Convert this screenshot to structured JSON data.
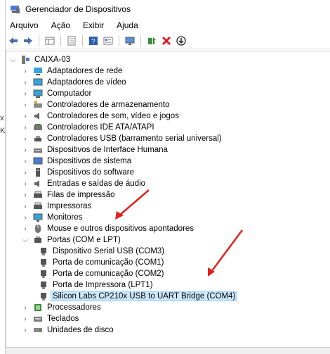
{
  "window": {
    "title": "Gerenciador de Dispositivos"
  },
  "menu": [
    "Arquivo",
    "Ação",
    "Exibir",
    "Ajuda"
  ],
  "toolbar": [
    "back-icon",
    "forward-icon",
    "properties-grid-icon",
    "document-icon",
    "help-icon",
    "grid-view-icon",
    "monitor-scan-icon",
    "driver-update-icon",
    "uninstall-x-icon",
    "download-icon"
  ],
  "tree": {
    "root": "CAIXA-03",
    "categories": [
      "Adaptadores de rede",
      "Adaptadores de vídeo",
      "Computador",
      "Controladores de armazenamento",
      "Controladores de som, vídeo e jogos",
      "Controladores IDE ATA/ATAPI",
      "Controladores USB (barramento serial universal)",
      "Dispositivos de Interface Humana",
      "Dispositivos de sistema",
      "Dispositivos do software",
      "Entradas e saídas de áudio",
      "Filas de impressão",
      "Impressoras",
      "Monitores",
      "Mouse e outros dispositivos apontadores",
      "Portas (COM e LPT)",
      "Processadores",
      "Teclados",
      "Unidades de disco"
    ],
    "ports_children": [
      "Dispositivo Serial USB (COM3)",
      "Porta de comunicação (COM1)",
      "Porta de comunicação (COM2)",
      "Porta de Impressora (LPT1)",
      "Silicon Labs CP210x USB to UART Bridge (COM4)"
    ]
  },
  "left_fragments": [
    "x",
    "K"
  ],
  "colors": {
    "selection": "#cce8ff",
    "annotation_arrow": "#e02020"
  }
}
